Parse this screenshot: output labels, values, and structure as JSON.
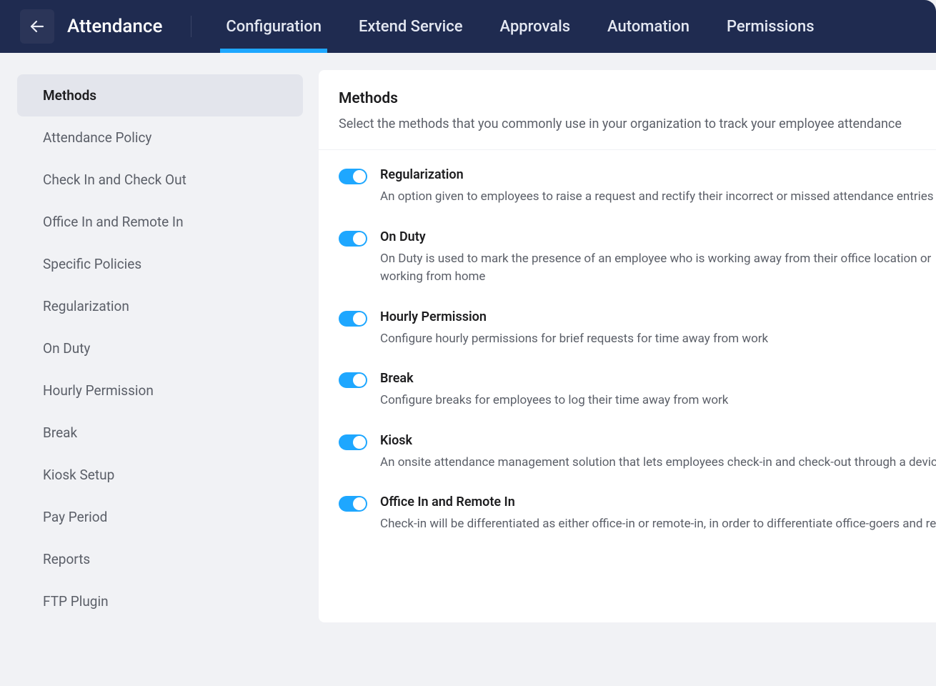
{
  "header": {
    "title": "Attendance",
    "nav": [
      {
        "label": "Configuration",
        "active": true
      },
      {
        "label": "Extend Service",
        "active": false
      },
      {
        "label": "Approvals",
        "active": false
      },
      {
        "label": "Automation",
        "active": false
      },
      {
        "label": "Permissions",
        "active": false
      }
    ]
  },
  "sidebar": {
    "items": [
      {
        "label": "Methods",
        "active": true
      },
      {
        "label": "Attendance Policy",
        "active": false
      },
      {
        "label": "Check In and Check Out",
        "active": false
      },
      {
        "label": "Office In and Remote In",
        "active": false
      },
      {
        "label": "Specific Policies",
        "active": false
      },
      {
        "label": "Regularization",
        "active": false
      },
      {
        "label": "On Duty",
        "active": false
      },
      {
        "label": "Hourly Permission",
        "active": false
      },
      {
        "label": "Break",
        "active": false
      },
      {
        "label": "Kiosk Setup",
        "active": false
      },
      {
        "label": "Pay Period",
        "active": false
      },
      {
        "label": "Reports",
        "active": false
      },
      {
        "label": "FTP Plugin",
        "active": false
      }
    ]
  },
  "content": {
    "title": "Methods",
    "subtitle": "Select the methods that you commonly use in your organization to track your employee attendance",
    "methods": [
      {
        "title": "Regularization",
        "desc": "An option given to employees to raise a request and rectify their incorrect or missed attendance entries",
        "enabled": true
      },
      {
        "title": "On Duty",
        "desc": "On Duty is used to mark the presence of an employee who is working away from their office location or working from home",
        "enabled": true,
        "wrap": true
      },
      {
        "title": "Hourly Permission",
        "desc": "Configure hourly permissions for brief requests for time away from work",
        "enabled": true
      },
      {
        "title": "Break",
        "desc": "Configure breaks for employees to log their time away from work",
        "enabled": true
      },
      {
        "title": "Kiosk",
        "desc": "An onsite attendance management solution that lets employees check-in and check-out through a device",
        "enabled": true
      },
      {
        "title": "Office In and Remote In",
        "desc": "Check-in will be differentiated as either office-in or remote-in, in order to differentiate office-goers and remote workers",
        "enabled": true
      }
    ]
  }
}
